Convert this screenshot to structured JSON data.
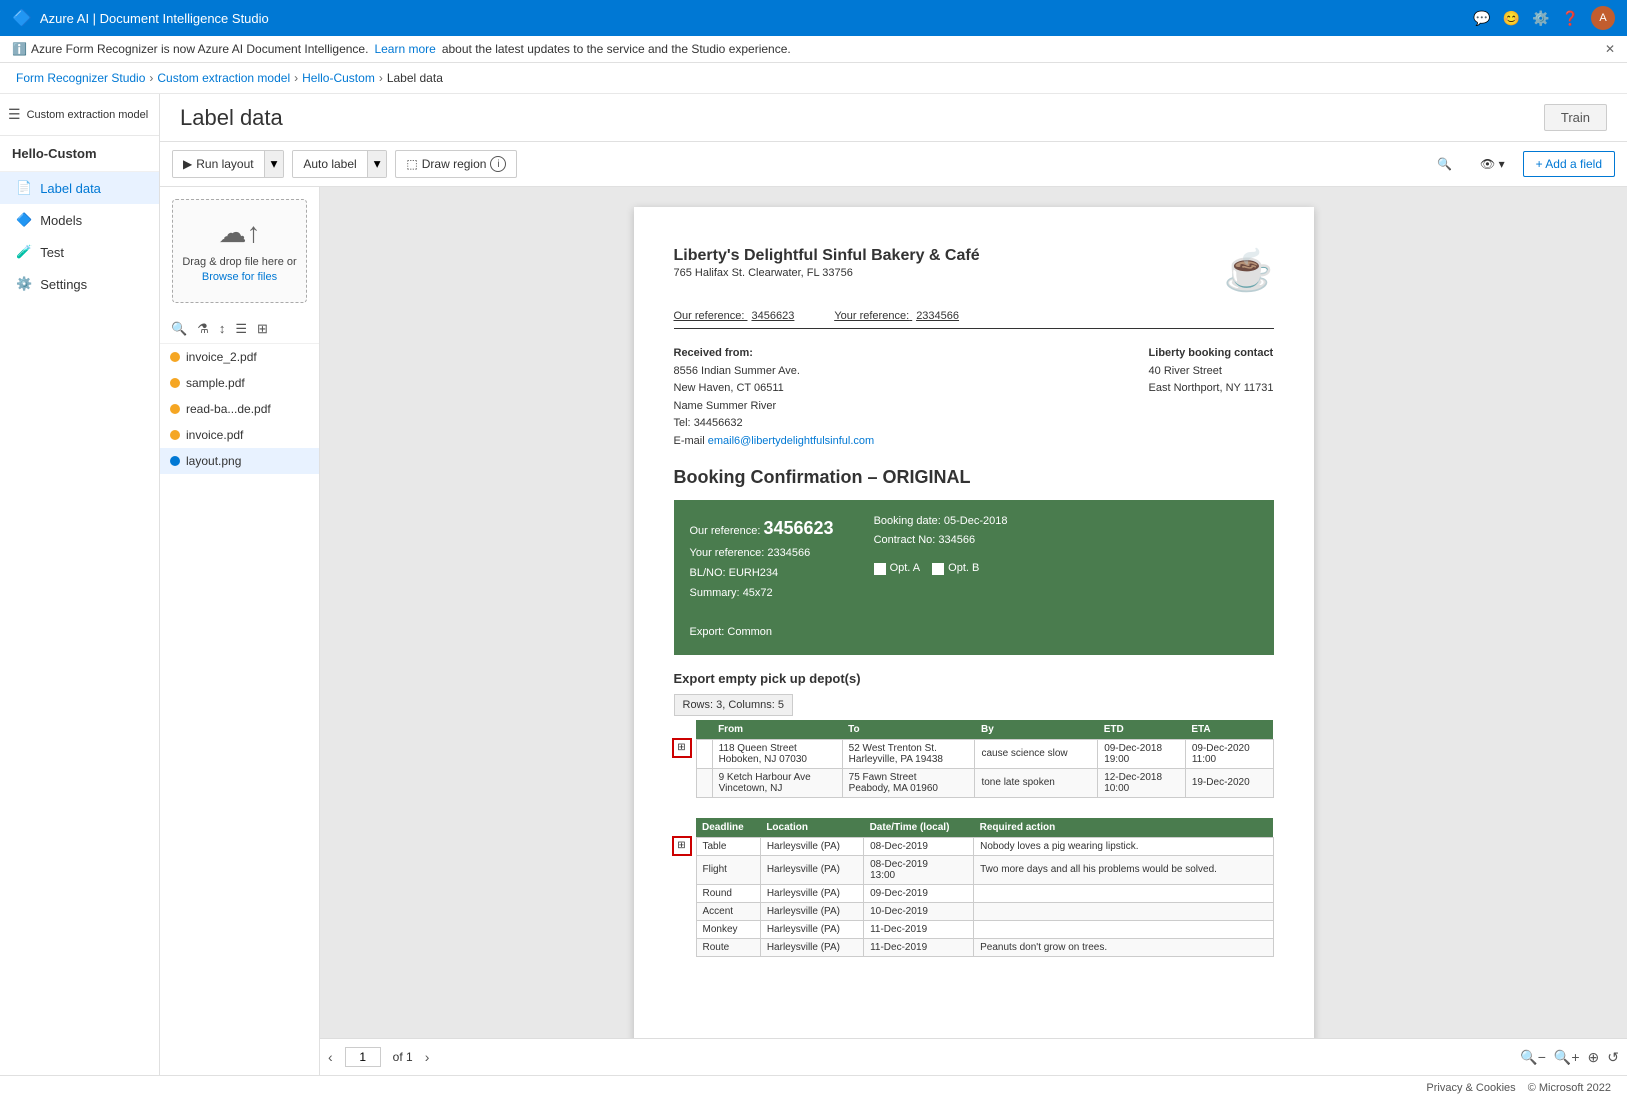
{
  "app": {
    "title": "Azure AI | Document Intelligence Studio",
    "notif_text": "Azure Form Recognizer is now Azure AI Document Intelligence.",
    "notif_link": "Learn more",
    "notif_suffix": "about the latest updates to the service and the Studio experience."
  },
  "breadcrumb": {
    "items": [
      {
        "label": "Form Recognizer Studio",
        "href": true
      },
      {
        "label": "Custom extraction model",
        "href": true
      },
      {
        "label": "Hello-Custom",
        "href": true
      },
      {
        "label": "Label data",
        "href": false
      }
    ]
  },
  "sidebar": {
    "toggle_title": "Collapse",
    "model_name": "Custom extraction model",
    "project_name": "Hello-Custom",
    "items": [
      {
        "label": "Label data",
        "icon": "📄",
        "active": true
      },
      {
        "label": "Models",
        "icon": "🔷"
      },
      {
        "label": "Test",
        "icon": "🔬"
      },
      {
        "label": "Settings",
        "icon": "⚙️"
      }
    ]
  },
  "page": {
    "title": "Label data",
    "train_button": "Train"
  },
  "toolbar": {
    "run_layout": "Run layout",
    "auto_label": "Auto label",
    "draw_region": "Draw region",
    "add_field": "+ Add a field"
  },
  "file_panel": {
    "upload_text": "Drag & drop file here or",
    "upload_link": "Browse for files",
    "files": [
      {
        "name": "invoice_2.pdf",
        "status": "orange",
        "active": false
      },
      {
        "name": "sample.pdf",
        "status": "orange",
        "active": false
      },
      {
        "name": "read-ba...de.pdf",
        "status": "orange",
        "active": false
      },
      {
        "name": "invoice.pdf",
        "status": "orange",
        "active": false
      },
      {
        "name": "layout.png",
        "status": "blue",
        "active": true
      }
    ]
  },
  "document": {
    "company": "Liberty's Delightful Sinful Bakery & Café",
    "address": "765 Halifax St. Clearwater, FL 33756",
    "our_ref_label": "Our reference:",
    "our_ref_val": "3456623",
    "your_ref_label": "Your reference:",
    "your_ref_val": "2334566",
    "received_from_label": "Received from:",
    "received_from_addr": "8556 Indian Summer Ave.\nNew Haven, CT 06511",
    "contact_label": "Liberty booking contact",
    "contact_addr": "40 River Street\nEast Northport, NY 11731",
    "name_label": "Name",
    "name_val": "Summer River",
    "tel_label": "Tel:",
    "tel_val": "34456632",
    "email_label": "E-mail",
    "email_val": "email6@libertydelightfulsinful.com",
    "booking_title": "Booking Confirmation – ORIGINAL",
    "green_box": {
      "our_ref_label": "Our reference:",
      "our_ref_val": "3456623",
      "your_ref_label": "Your reference:",
      "your_ref_val": "2334566",
      "blno_label": "BL/NO:",
      "blno_val": "EURH234",
      "summary_label": "Summary:",
      "summary_val": "45x72",
      "booking_date_label": "Booking date:",
      "booking_date_val": "05-Dec-2018",
      "contract_label": "Contract No:",
      "contract_val": "334566",
      "opt_a": "Opt. A",
      "opt_b": "Opt. B",
      "export_label": "Export:",
      "export_val": "Common"
    },
    "export_section_title": "Export empty pick up depot(s)",
    "tooltip": "Rows: 3, Columns: 5",
    "table1": {
      "headers": [
        "",
        "From",
        "To",
        "By",
        "ETD",
        "ETA"
      ],
      "rows": [
        [
          "118 Queen Street\nHoboken, NJ 07030",
          "52 West Trenton St.\nHarleyville, PA 19438",
          "cause science slow",
          "09-Dec-2018\n19:00",
          "09-Dec-2020\n11:00"
        ],
        [
          "9 Ketch Harbour\nAve\nVincetown, NJ",
          "75 Fawn Street\nPeabody, MA 01960",
          "tone late spoken",
          "12-Dec-2018\n10:00",
          "19-Dec-2020"
        ]
      ]
    },
    "table2": {
      "headers": [
        "Deadline",
        "Location",
        "Date/Time (local)",
        "Required action"
      ],
      "rows": [
        [
          "Table",
          "Harleysville (PA)",
          "08-Dec-2019",
          "Nobody loves a pig wearing lipstick."
        ],
        [
          "Flight",
          "Harleysville (PA)",
          "08-Dec-2019\n13:00",
          "Two more days and all his problems would be solved."
        ],
        [
          "Round",
          "Harleysville (PA)",
          "09-Dec-2019",
          ""
        ],
        [
          "Accent",
          "Harleysville (PA)",
          "10-Dec-2019",
          ""
        ],
        [
          "Monkey",
          "Harleysville (PA)",
          "11-Dec-2019",
          ""
        ],
        [
          "Route",
          "Harleysville (PA)",
          "11-Dec-2019",
          "Peanuts don't grow on trees."
        ]
      ]
    }
  },
  "doc_footer": {
    "page_current": "1",
    "page_total": "of 1"
  },
  "privacy_footer": {
    "privacy": "Privacy & Cookies",
    "copyright": "© Microsoft 2022"
  }
}
